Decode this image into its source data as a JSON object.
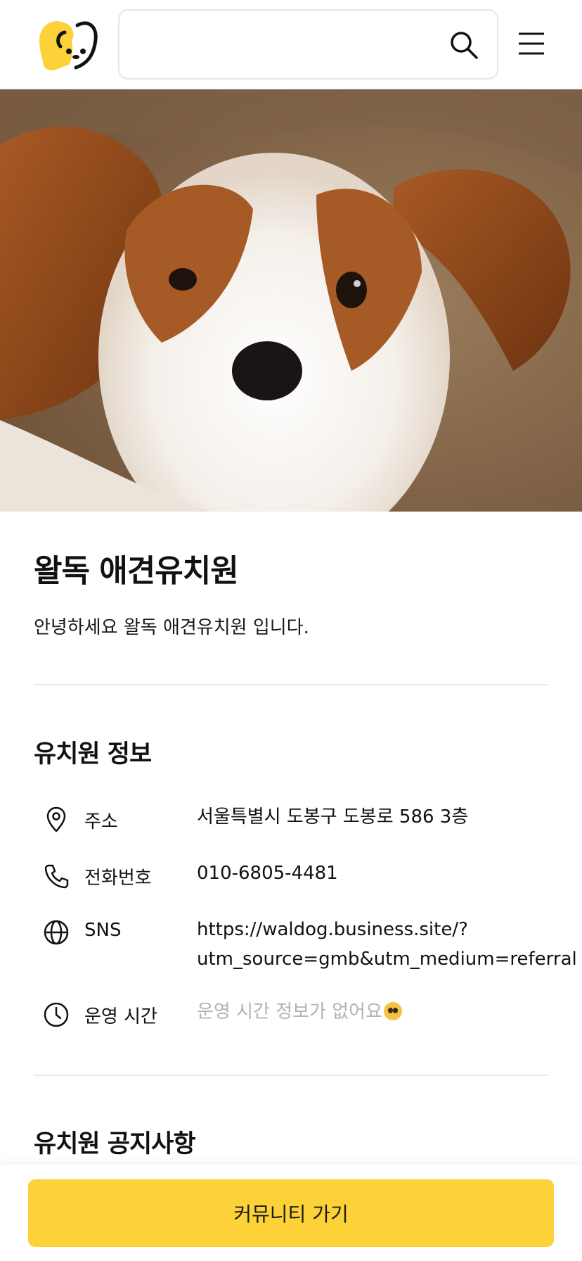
{
  "header": {
    "logo_icon": "dog-face-logo",
    "search": {
      "value": "",
      "placeholder": ""
    },
    "search_icon": "search-icon",
    "menu_icon": "hamburger-menu-icon"
  },
  "hero": {
    "alt": "puppy photo"
  },
  "kindergarten": {
    "name": "왈독 애견유치원",
    "intro": "안녕하세요 왈독 애견유치원 입니다."
  },
  "info_section": {
    "title": "유치원 정보",
    "rows": [
      {
        "icon": "location-pin-icon",
        "label": "주소",
        "value": "서울특별시 도봉구 도봉로 586 3층"
      },
      {
        "icon": "phone-icon",
        "label": "전화번호",
        "value": "010-6805-4481"
      },
      {
        "icon": "globe-icon",
        "label": "SNS",
        "value_line1": "https://waldog.business.site/?",
        "value_line2": "utm_source=gmb&utm_medium=referral"
      },
      {
        "icon": "clock-icon",
        "label": "운영 시간",
        "value": "운영 시간 정보가 없어요"
      }
    ]
  },
  "notice_section": {
    "title": "유치원 공지사항"
  },
  "cta": {
    "label": "커뮤니티 가기"
  },
  "colors": {
    "accent": "#fdd138",
    "muted_text": "#b3b3b3",
    "divider": "#ebebeb"
  }
}
